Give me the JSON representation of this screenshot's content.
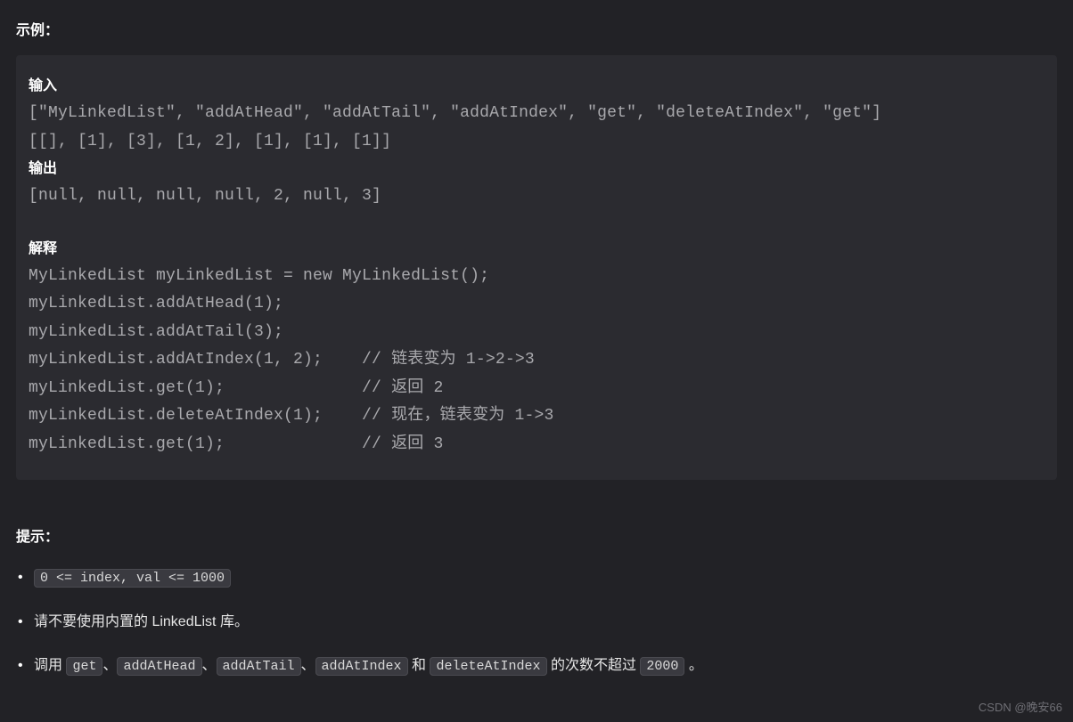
{
  "example_label": "示例：",
  "code": {
    "input_label": "输入",
    "input_line1": "[\"MyLinkedList\", \"addAtHead\", \"addAtTail\", \"addAtIndex\", \"get\", \"deleteAtIndex\", \"get\"]",
    "input_line2": "[[], [1], [3], [1, 2], [1], [1], [1]]",
    "output_label": "输出",
    "output_line": "[null, null, null, null, 2, null, 3]",
    "explain_label": "解释",
    "explain_lines": [
      "MyLinkedList myLinkedList = new MyLinkedList();",
      "myLinkedList.addAtHead(1);",
      "myLinkedList.addAtTail(3);",
      "myLinkedList.addAtIndex(1, 2);    // 链表变为 1->2->3",
      "myLinkedList.get(1);              // 返回 2",
      "myLinkedList.deleteAtIndex(1);    // 现在，链表变为 1->3",
      "myLinkedList.get(1);              // 返回 3"
    ]
  },
  "hints_label": "提示：",
  "hints": {
    "item1_code": "0 <= index, val <= 1000",
    "item2_text": "请不要使用内置的 LinkedList 库。",
    "item3": {
      "prefix": "调用 ",
      "c1": "get",
      "sep1": "、",
      "c2": "addAtHead",
      "sep2": "、",
      "c3": "addAtTail",
      "sep3": "、",
      "c4": "addAtIndex",
      "and": " 和 ",
      "c5": "deleteAtIndex",
      "mid": " 的次数不超过 ",
      "c6": "2000",
      "suffix": " 。"
    }
  },
  "watermark": "CSDN @晚安66"
}
